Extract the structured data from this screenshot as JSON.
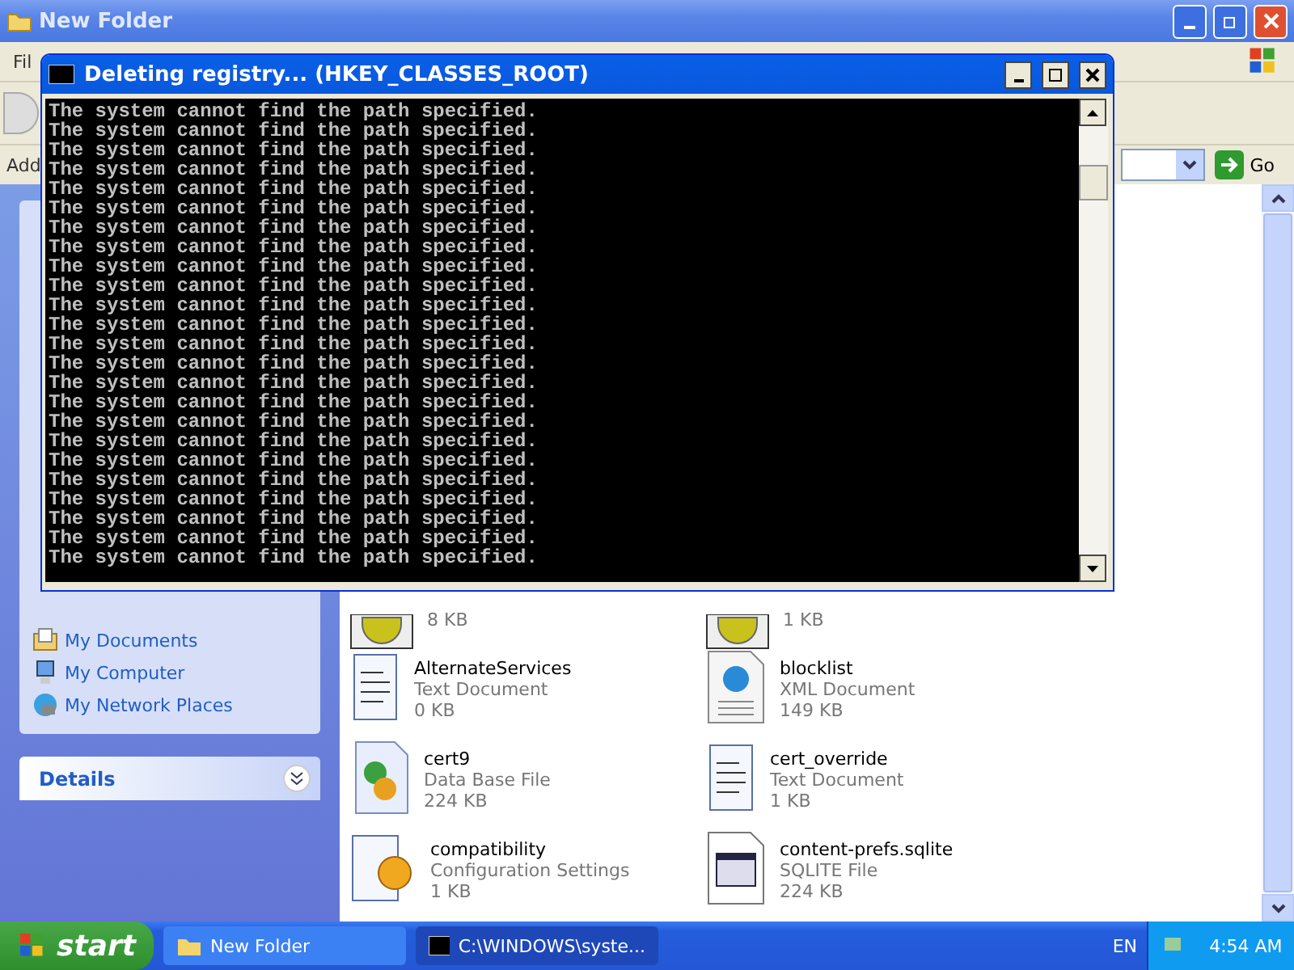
{
  "explorer": {
    "title": "New Folder",
    "menu": "Fil",
    "address_label": "Add",
    "go": "Go",
    "tasks": [
      {
        "label": "My Documents",
        "kind": "docs"
      },
      {
        "label": "My Computer",
        "kind": "computer"
      },
      {
        "label": "My Network Places",
        "kind": "network"
      }
    ],
    "details": "Details",
    "files": [
      {
        "kind": "batch",
        "size": "8 KB"
      },
      {
        "kind": "batch",
        "size": "1 KB"
      },
      {
        "kind": "text",
        "name": "AlternateServices",
        "type": "Text Document",
        "size": "0 KB"
      },
      {
        "kind": "xml",
        "name": "blocklist",
        "type": "XML Document",
        "size": "149 KB"
      },
      {
        "kind": "db",
        "name": "cert9",
        "type": "Data Base File",
        "size": "224 KB"
      },
      {
        "kind": "text",
        "name": "cert_override",
        "type": "Text Document",
        "size": "1 KB"
      },
      {
        "kind": "config",
        "name": "compatibility",
        "type": "Configuration Settings",
        "size": "1 KB"
      },
      {
        "kind": "sqlite",
        "name": "content-prefs.sqlite",
        "type": "SQLITE File",
        "size": "224 KB"
      }
    ]
  },
  "console": {
    "title": "Deleting registry... (HKEY_CLASSES_ROOT)",
    "lines": [
      "The system cannot find the path specified.",
      "The system cannot find the path specified.",
      "The system cannot find the path specified.",
      "The system cannot find the path specified.",
      "The system cannot find the path specified.",
      "The system cannot find the path specified.",
      "The system cannot find the path specified.",
      "The system cannot find the path specified.",
      "The system cannot find the path specified.",
      "The system cannot find the path specified.",
      "The system cannot find the path specified.",
      "The system cannot find the path specified.",
      "The system cannot find the path specified.",
      "The system cannot find the path specified.",
      "The system cannot find the path specified.",
      "The system cannot find the path specified.",
      "The system cannot find the path specified.",
      "The system cannot find the path specified.",
      "The system cannot find the path specified.",
      "The system cannot find the path specified.",
      "The system cannot find the path specified.",
      "The system cannot find the path specified.",
      "The system cannot find the path specified.",
      "The system cannot find the path specified."
    ]
  },
  "taskbar": {
    "start": "start",
    "items": [
      {
        "label": "New Folder",
        "kind": "folder",
        "selected": false
      },
      {
        "label": "C:\\WINDOWS\\syste...",
        "kind": "console",
        "selected": true
      }
    ],
    "language": "EN",
    "clock": "4:54 AM"
  }
}
